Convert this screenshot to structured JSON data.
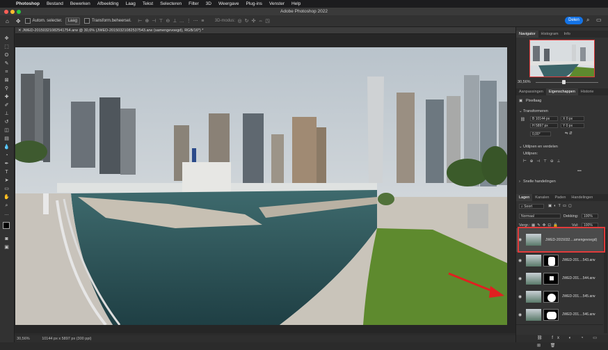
{
  "menubar": {
    "app": "Photoshop",
    "items": [
      "Bestand",
      "Bewerken",
      "Afbeelding",
      "Laag",
      "Tekst",
      "Selecteren",
      "Filter",
      "3D",
      "Weergave",
      "Plug-ins",
      "Venster",
      "Help"
    ]
  },
  "window_title": "Adobe Photoshop 2022",
  "options": {
    "auto_select_label": "Autom. selecter.",
    "auto_select_target": "Laag",
    "transform_label": "Transform.beheersel.",
    "mode_3d": "3D-modus:",
    "share_label": "Delen"
  },
  "document_tab": "JWED-20150321082541754.arw @ 30,6% (JWED-20150321082537543.arw (samengevoegd), RGB/16*) *",
  "statusbar": {
    "zoom": "30,56%",
    "info": "10144 px x 5897 px (300 ppi)"
  },
  "navigator": {
    "tabs": [
      "Navigator",
      "Histogram",
      "Info"
    ],
    "zoom": "30,56%"
  },
  "properties": {
    "tabs": [
      "Aanpassingen",
      "Eigenschappen",
      "Historie"
    ],
    "kind": "Pixellaag",
    "section_transform": "Transformeren",
    "w": "B  10144 px",
    "h": "H  5897 px",
    "x": "X  0 px",
    "y": "Y  0 px",
    "angle": "0,00°",
    "section_align": "Uitlijnen en verdelen",
    "align_sub": "Uitlijnen:",
    "quick_actions": "Snelle handelingen"
  },
  "layers": {
    "tabs": [
      "Lagen",
      "Kanalen",
      "Paden",
      "Handelingen"
    ],
    "filter": "Soort",
    "blend_mode": "Normaal",
    "opacity_label": "Dekking:",
    "opacity": "100%",
    "lock_label": "Vergr.:",
    "fill_label": "Vul:",
    "fill": "100%",
    "items": [
      {
        "name": "JWED-2015032....amengevoegd)",
        "selected": true,
        "mask": false
      },
      {
        "name": "JWED-201....543.arw",
        "selected": false,
        "mask": true
      },
      {
        "name": "JWED-201....544.arw",
        "selected": false,
        "mask": true
      },
      {
        "name": "JWED-201....545.arw",
        "selected": false,
        "mask": true
      },
      {
        "name": "JWED-201....546.arw",
        "selected": false,
        "mask": true
      }
    ]
  },
  "colors": {
    "accent": "#1473e6",
    "highlight_box": "#e23b3b",
    "annotation_arrow": "#e02020"
  }
}
